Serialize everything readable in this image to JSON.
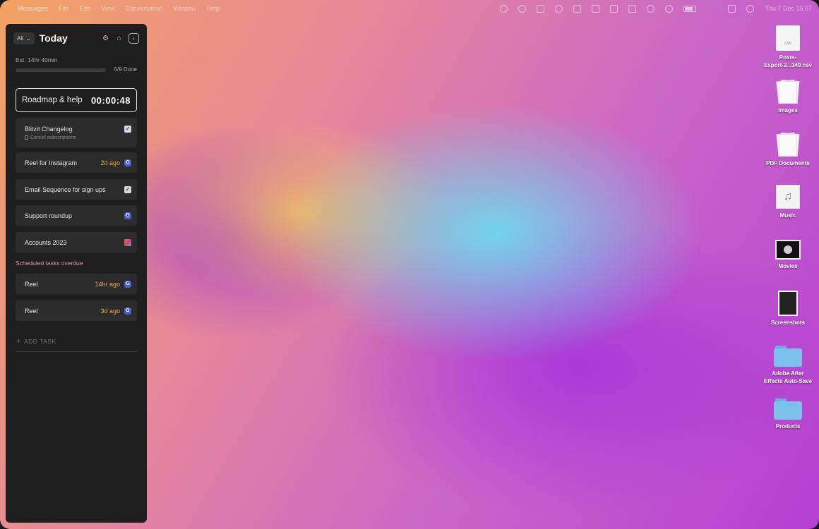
{
  "menubar": {
    "app_name": "Messages",
    "menus": [
      "File",
      "Edit",
      "View",
      "Conversation",
      "Window",
      "Help"
    ],
    "datetime": "Thu 7 Dec  15:07"
  },
  "panel": {
    "filter": "All",
    "title": "Today",
    "estimate": "Est: 14hr 40min",
    "progress": {
      "done_count": 0,
      "total": 9,
      "fraction": 0.0,
      "label": "0/9 Done"
    },
    "timer": {
      "label": "Roadmap & help",
      "time": "00:00:48"
    },
    "tasks": [
      {
        "title": "Blitzit Changelog",
        "note": "Cancel subscriptions",
        "icon": "check-icon"
      },
      {
        "title": "Reel for Instagram",
        "ago": "2d ago",
        "icon": "g-app-icon"
      },
      {
        "title": "Email Sequence for sign ups",
        "icon": "check-icon"
      },
      {
        "title": "Support roundup",
        "icon": "g-app-icon"
      },
      {
        "title": "Accounts 2023",
        "icon": "photo-app-icon"
      }
    ],
    "overdue_label": "Scheduled tasks overdue",
    "overdue": [
      {
        "title": "Reel",
        "ago": "14hr ago",
        "icon": "g-app-icon"
      },
      {
        "title": "Reel",
        "ago": "3d ago",
        "icon": "g-app-icon"
      }
    ],
    "add_task": "ADD TASK"
  },
  "desktop": [
    {
      "label_line1": "Posts-",
      "label_line2": "Export-2...349.csv",
      "kind": "csv-file-icon",
      "thumb_text": "CSV"
    },
    {
      "label_line1": "Images",
      "kind": "stack-icon"
    },
    {
      "label_line1": "PDF Documents",
      "kind": "stack-icon"
    },
    {
      "label_line1": "Music",
      "kind": "music-stack-icon"
    },
    {
      "label_line1": "Movies",
      "kind": "movie-stack-icon"
    },
    {
      "label_line1": "Screenshots",
      "kind": "screenshot-stack-icon"
    },
    {
      "label_line1": "Adobe After",
      "label_line2": "Effects Auto-Save",
      "kind": "folder-icon"
    },
    {
      "label_line1": "Products",
      "kind": "folder-icon"
    }
  ],
  "colors": {
    "accent_orange": "#e7a64f",
    "overdue_pink": "#e294b5",
    "folder_blue": "#7ec0ec"
  }
}
